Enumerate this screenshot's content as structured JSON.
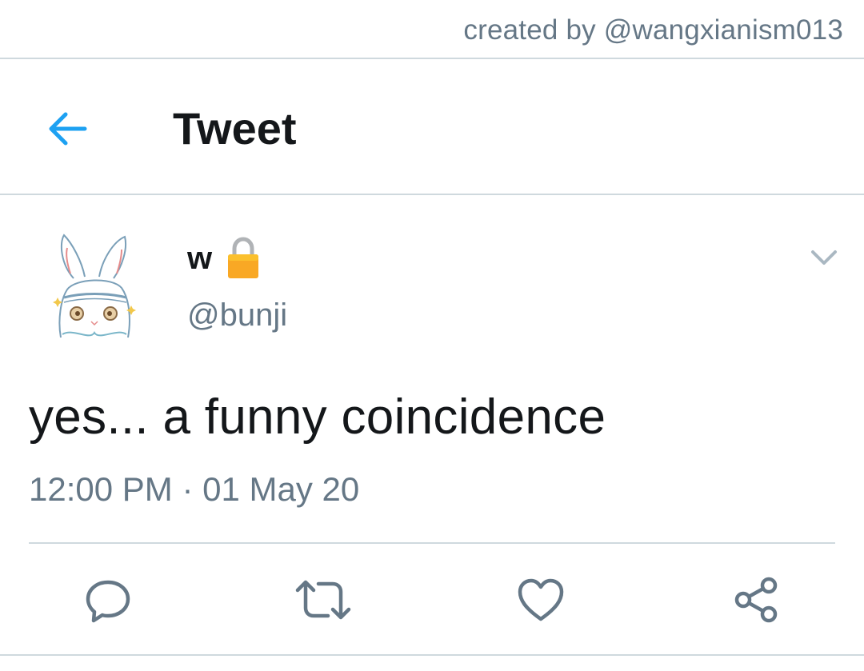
{
  "watermark": "created by @wangxianism013",
  "header": {
    "back_icon": "arrow-left-icon",
    "title": "Tweet",
    "accent_color": "#1da1f2"
  },
  "tweet": {
    "author": {
      "display_name": "w",
      "protected_icon": "lock-icon",
      "handle": "@bunji",
      "avatar": "white-bunny-avatar"
    },
    "menu_icon": "chevron-down-icon",
    "text": "yes... a funny coincidence",
    "timestamp": "12:00 PM · 01 May 20"
  },
  "actions": [
    {
      "name": "reply",
      "icon": "reply-icon"
    },
    {
      "name": "retweet",
      "icon": "retweet-icon"
    },
    {
      "name": "like",
      "icon": "heart-icon"
    },
    {
      "name": "share",
      "icon": "share-icon"
    }
  ],
  "colors": {
    "text_primary": "#14171a",
    "text_secondary": "#657786",
    "divider": "#cfd9de"
  }
}
